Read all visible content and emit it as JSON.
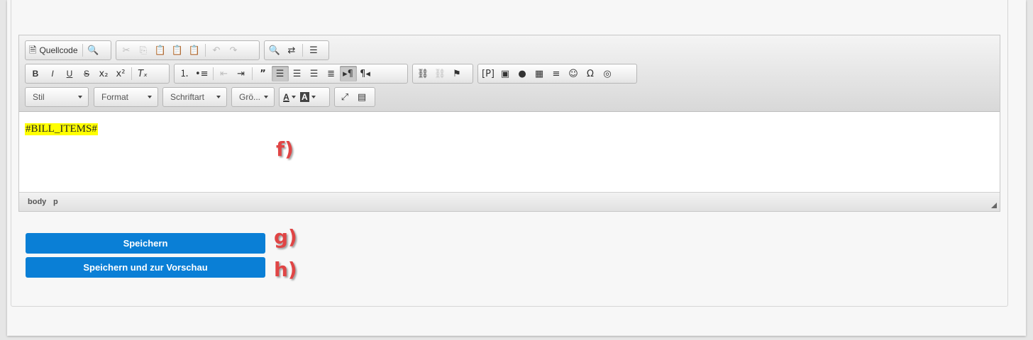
{
  "toolbar": {
    "source_label": "Quellcode",
    "stil_label": "Stil",
    "format_label": "Format",
    "schriftart_label": "Schriftart",
    "groesse_label": "Grö...",
    "text_color_label": "A",
    "bg_color_label": "A"
  },
  "editor": {
    "content_text": "#BILL_ITEMS#",
    "path": [
      "body",
      "p"
    ]
  },
  "actions": {
    "save_label": "Speichern",
    "save_preview_label": "Speichern und zur Vorschau"
  },
  "annotations": {
    "f": "f)",
    "g": "g)",
    "h": "h)"
  },
  "colors": {
    "accent": "#0a7fd6",
    "highlight": "#ffff00",
    "annotation": "#e04545"
  }
}
